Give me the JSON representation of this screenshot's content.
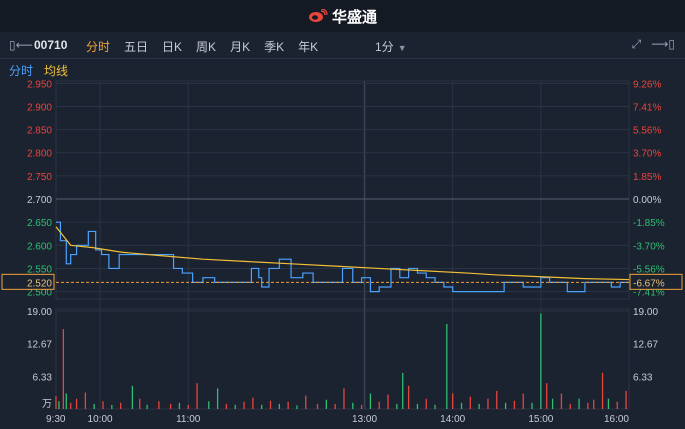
{
  "app": {
    "brand": "华盛通",
    "brand_icon": "weibo-style-logo-icon"
  },
  "toolbar": {
    "stock_code": "00710",
    "periods": [
      "分时",
      "五日",
      "日K",
      "周K",
      "月K",
      "季K",
      "年K"
    ],
    "active_period": "分时",
    "interval": "1分",
    "left_icon": "collapse-left-icon",
    "right_icons": [
      "fullscreen-icon",
      "expand-right-icon"
    ]
  },
  "subtabs": {
    "timeshare": "分时",
    "avg_line": "均线"
  },
  "colors": {
    "background": "#1b2230",
    "price_line": "#4aa3ff",
    "avg_line": "#f2c037",
    "up": "#e8453c",
    "down": "#2fbf71",
    "grid": "#2b3444",
    "current_price_box": "#f2a33a"
  },
  "chart_data": {
    "type": "line",
    "price_axis": {
      "ticks": [
        "2.950",
        "2.900",
        "2.850",
        "2.800",
        "2.750",
        "2.700",
        "2.650",
        "2.600",
        "2.550",
        "2.500"
      ],
      "values": [
        2.95,
        2.9,
        2.85,
        2.8,
        2.75,
        2.7,
        2.65,
        2.6,
        2.55,
        2.5
      ],
      "prev_close": 2.7,
      "ylim": [
        2.484,
        2.955
      ]
    },
    "pct_axis": {
      "ticks": [
        "9.26%",
        "7.41%",
        "5.56%",
        "3.70%",
        "1.85%",
        "0.00%",
        "-1.85%",
        "-3.70%",
        "-5.56%",
        "-7.41%"
      ]
    },
    "current_price": {
      "price_label": "2.520",
      "pct_label": "-6.67%",
      "value": 2.52
    },
    "time_axis": {
      "labels": [
        "9:30",
        "10:00",
        "11:00",
        "13:00",
        "14:00",
        "15:00",
        "16:00"
      ]
    },
    "series": [
      {
        "name": "分时",
        "color": "#4aa3ff",
        "x_minutes": [
          0,
          3,
          7,
          10,
          14,
          18,
          22,
          27,
          31,
          36,
          43,
          50,
          57,
          64,
          72,
          80,
          86,
          93,
          100,
          108,
          116,
          122,
          128,
          133,
          138,
          140,
          145,
          152,
          160,
          168,
          175,
          182,
          188,
          195,
          202,
          208,
          214,
          220,
          228,
          234,
          240,
          246,
          252,
          258,
          264,
          270,
          276,
          282,
          288,
          296,
          300,
          305,
          312,
          318,
          324,
          330,
          336,
          342,
          348,
          354,
          360,
          366,
          372,
          378,
          384,
          390
        ],
        "values": [
          2.65,
          2.61,
          2.56,
          2.58,
          2.6,
          2.6,
          2.63,
          2.59,
          2.58,
          2.55,
          2.58,
          2.58,
          2.58,
          2.58,
          2.58,
          2.55,
          2.54,
          2.52,
          2.53,
          2.52,
          2.52,
          2.52,
          2.52,
          2.55,
          2.53,
          2.51,
          2.55,
          2.57,
          2.53,
          2.54,
          2.52,
          2.52,
          2.52,
          2.55,
          2.52,
          2.53,
          2.5,
          2.51,
          2.55,
          2.53,
          2.55,
          2.54,
          2.53,
          2.52,
          2.51,
          2.5,
          2.5,
          2.5,
          2.5,
          2.5,
          2.5,
          2.52,
          2.52,
          2.51,
          2.51,
          2.53,
          2.52,
          2.52,
          2.5,
          2.5,
          2.52,
          2.52,
          2.52,
          2.51,
          2.52,
          2.52
        ]
      },
      {
        "name": "均线",
        "color": "#f2c037",
        "x_minutes": [
          0,
          10,
          25,
          45,
          70,
          100,
          130,
          160,
          190,
          220,
          250,
          280,
          300,
          330,
          360,
          390
        ],
        "values": [
          2.64,
          2.6,
          2.595,
          2.585,
          2.578,
          2.57,
          2.565,
          2.56,
          2.555,
          2.55,
          2.545,
          2.54,
          2.536,
          2.532,
          2.528,
          2.526
        ]
      }
    ],
    "volume": {
      "axis_ticks": [
        "19.00",
        "12.67",
        "6.33",
        "万"
      ],
      "ticks_right": [
        "19.00",
        "12.67",
        "6.33"
      ],
      "ylim": [
        0,
        19
      ],
      "bars": [
        {
          "t": 0,
          "v": 2.5,
          "c": "up"
        },
        {
          "t": 2,
          "v": 1.5,
          "c": "down"
        },
        {
          "t": 5,
          "v": 15.5,
          "c": "up"
        },
        {
          "t": 7,
          "v": 3.0,
          "c": "down"
        },
        {
          "t": 10,
          "v": 1.2,
          "c": "up"
        },
        {
          "t": 14,
          "v": 2.0,
          "c": "up"
        },
        {
          "t": 20,
          "v": 3.2,
          "c": "up"
        },
        {
          "t": 26,
          "v": 1.0,
          "c": "down"
        },
        {
          "t": 32,
          "v": 1.5,
          "c": "up"
        },
        {
          "t": 38,
          "v": 0.8,
          "c": "down"
        },
        {
          "t": 44,
          "v": 1.2,
          "c": "up"
        },
        {
          "t": 52,
          "v": 4.5,
          "c": "down"
        },
        {
          "t": 57,
          "v": 2.0,
          "c": "up"
        },
        {
          "t": 62,
          "v": 0.8,
          "c": "down"
        },
        {
          "t": 70,
          "v": 1.5,
          "c": "up"
        },
        {
          "t": 78,
          "v": 1.0,
          "c": "up"
        },
        {
          "t": 84,
          "v": 1.2,
          "c": "down"
        },
        {
          "t": 90,
          "v": 0.8,
          "c": "up"
        },
        {
          "t": 96,
          "v": 5.0,
          "c": "up"
        },
        {
          "t": 104,
          "v": 1.5,
          "c": "down"
        },
        {
          "t": 110,
          "v": 4.0,
          "c": "down"
        },
        {
          "t": 116,
          "v": 1.0,
          "c": "up"
        },
        {
          "t": 122,
          "v": 0.8,
          "c": "down"
        },
        {
          "t": 128,
          "v": 1.4,
          "c": "up"
        },
        {
          "t": 134,
          "v": 2.2,
          "c": "up"
        },
        {
          "t": 140,
          "v": 0.8,
          "c": "down"
        },
        {
          "t": 146,
          "v": 1.6,
          "c": "up"
        },
        {
          "t": 152,
          "v": 1.0,
          "c": "down"
        },
        {
          "t": 158,
          "v": 1.4,
          "c": "up"
        },
        {
          "t": 164,
          "v": 0.7,
          "c": "down"
        },
        {
          "t": 170,
          "v": 2.6,
          "c": "up"
        },
        {
          "t": 178,
          "v": 1.0,
          "c": "up"
        },
        {
          "t": 184,
          "v": 1.8,
          "c": "down"
        },
        {
          "t": 190,
          "v": 1.0,
          "c": "up"
        },
        {
          "t": 196,
          "v": 4.0,
          "c": "up"
        },
        {
          "t": 202,
          "v": 1.2,
          "c": "down"
        },
        {
          "t": 208,
          "v": 0.8,
          "c": "up"
        },
        {
          "t": 214,
          "v": 3.0,
          "c": "down"
        },
        {
          "t": 220,
          "v": 1.4,
          "c": "up"
        },
        {
          "t": 226,
          "v": 2.8,
          "c": "up"
        },
        {
          "t": 232,
          "v": 1.0,
          "c": "down"
        },
        {
          "t": 236,
          "v": 7.0,
          "c": "down"
        },
        {
          "t": 240,
          "v": 4.5,
          "c": "up"
        },
        {
          "t": 246,
          "v": 1.0,
          "c": "down"
        },
        {
          "t": 252,
          "v": 2.0,
          "c": "up"
        },
        {
          "t": 258,
          "v": 0.8,
          "c": "down"
        },
        {
          "t": 266,
          "v": 16.5,
          "c": "down"
        },
        {
          "t": 270,
          "v": 3.0,
          "c": "up"
        },
        {
          "t": 276,
          "v": 1.2,
          "c": "down"
        },
        {
          "t": 282,
          "v": 2.4,
          "c": "up"
        },
        {
          "t": 288,
          "v": 1.0,
          "c": "down"
        },
        {
          "t": 294,
          "v": 2.0,
          "c": "up"
        },
        {
          "t": 300,
          "v": 3.5,
          "c": "up"
        },
        {
          "t": 306,
          "v": 1.2,
          "c": "down"
        },
        {
          "t": 312,
          "v": 1.6,
          "c": "up"
        },
        {
          "t": 318,
          "v": 3.0,
          "c": "up"
        },
        {
          "t": 324,
          "v": 1.2,
          "c": "down"
        },
        {
          "t": 330,
          "v": 18.5,
          "c": "down"
        },
        {
          "t": 334,
          "v": 5.0,
          "c": "up"
        },
        {
          "t": 338,
          "v": 2.0,
          "c": "down"
        },
        {
          "t": 344,
          "v": 3.0,
          "c": "up"
        },
        {
          "t": 350,
          "v": 1.0,
          "c": "up"
        },
        {
          "t": 356,
          "v": 2.0,
          "c": "down"
        },
        {
          "t": 362,
          "v": 1.2,
          "c": "up"
        },
        {
          "t": 366,
          "v": 1.8,
          "c": "up"
        },
        {
          "t": 372,
          "v": 7.0,
          "c": "up"
        },
        {
          "t": 376,
          "v": 2.0,
          "c": "down"
        },
        {
          "t": 382,
          "v": 1.4,
          "c": "up"
        },
        {
          "t": 388,
          "v": 3.5,
          "c": "up"
        }
      ]
    }
  }
}
